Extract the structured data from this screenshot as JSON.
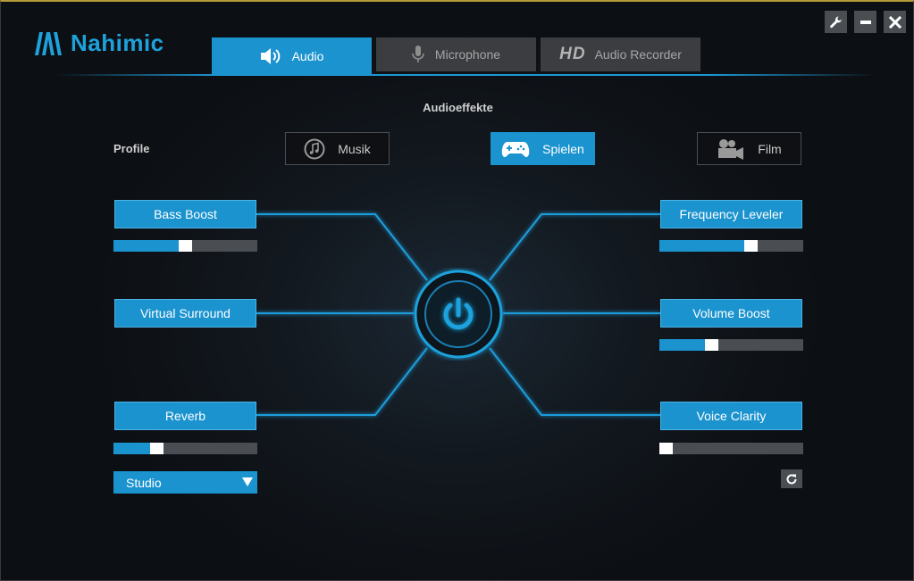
{
  "app": {
    "name": "Nahimic"
  },
  "tabs": [
    {
      "label": "Audio",
      "icon": "speaker-icon",
      "active": true
    },
    {
      "label": "Microphone",
      "icon": "microphone-icon",
      "active": false
    },
    {
      "label": "Audio Recorder",
      "badge": "HD",
      "active": false
    }
  ],
  "section_title": "Audioeffekte",
  "profiles": {
    "label": "Profile",
    "items": [
      {
        "label": "Musik",
        "icon": "music-note-icon",
        "active": false
      },
      {
        "label": "Spielen",
        "icon": "gamepad-icon",
        "active": true
      },
      {
        "label": "Film",
        "icon": "video-camera-icon",
        "active": false
      }
    ]
  },
  "effects": {
    "bass_boost": {
      "label": "Bass Boost",
      "level": 0.5
    },
    "virtual_surround": {
      "label": "Virtual Surround"
    },
    "reverb": {
      "label": "Reverb",
      "level": 0.28,
      "preset": "Studio"
    },
    "frequency_leveler": {
      "label": "Frequency Leveler",
      "level": 0.65
    },
    "volume_boost": {
      "label": "Volume Boost",
      "level": 0.35
    },
    "voice_clarity": {
      "label": "Voice Clarity",
      "level": 0.0
    }
  },
  "colors": {
    "accent": "#1b93cf",
    "glow": "#1ea2dc",
    "inactive": "#4a4d52",
    "background": "#0c0f13"
  }
}
